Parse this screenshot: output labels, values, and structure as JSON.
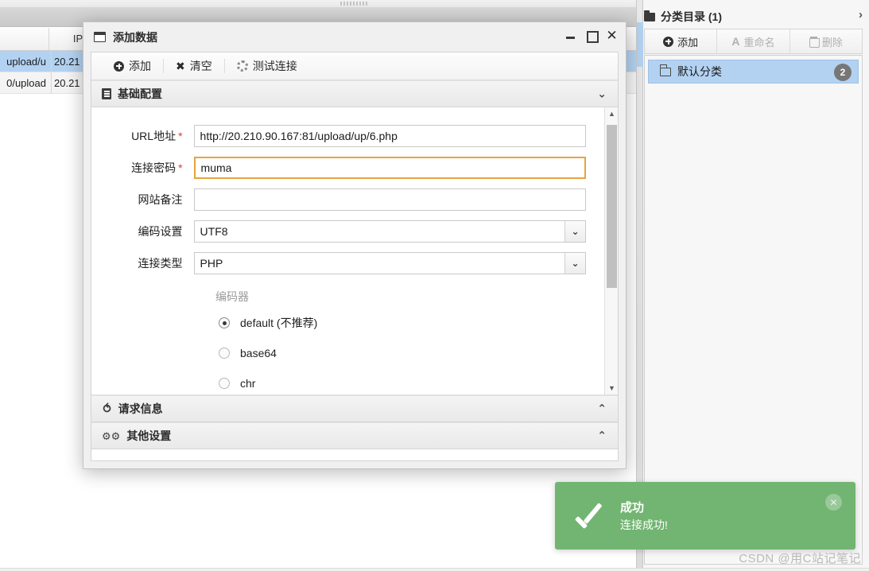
{
  "background": {
    "table": {
      "headers": [
        "",
        "IP地",
        ""
      ],
      "rows": [
        {
          "path": "upload/u",
          "ip": "20.21"
        },
        {
          "path": "0/upload",
          "ip": "20.21"
        }
      ]
    }
  },
  "sidebar": {
    "header_title": "分类目录 (1)",
    "header_icon": "folder-icon",
    "expand_icon": "chevron-right-icon",
    "toolbar": [
      {
        "label": "添加",
        "icon": "plus-circle-icon",
        "disabled": false
      },
      {
        "label": "重命名",
        "icon": "rename-A-icon",
        "disabled": true
      },
      {
        "label": "删除",
        "icon": "trash-icon",
        "disabled": true
      }
    ],
    "items": [
      {
        "label": "默认分类",
        "icon": "folder-outline-icon",
        "count": "2",
        "selected": true
      }
    ]
  },
  "dialog": {
    "title": "添加数据",
    "title_icon": "window-icon",
    "window_controls": {
      "minimize": "–",
      "maximize": "□",
      "close": "✕"
    },
    "toolbar": [
      {
        "label": "添加",
        "icon": "plus-circle-icon"
      },
      {
        "label": "清空",
        "icon": "x-icon"
      },
      {
        "label": "测试连接",
        "icon": "spinner-icon"
      }
    ],
    "sections": [
      {
        "title": "基础配置",
        "icon": "document-icon",
        "chevron": "⌄",
        "expanded": true
      },
      {
        "title": "请求信息",
        "icon": "refresh-icon",
        "chevron": "⌃",
        "expanded": false
      },
      {
        "title": "其他设置",
        "icon": "gears-icon",
        "chevron": "⌃",
        "expanded": false
      }
    ],
    "form": {
      "fields": [
        {
          "label": "URL地址",
          "required": true,
          "type": "text",
          "value": "http://20.210.90.167:81/upload/up/6.php",
          "placeholder": "",
          "focused": false
        },
        {
          "label": "连接密码",
          "required": true,
          "type": "text",
          "value": "muma",
          "placeholder": "",
          "focused": true
        },
        {
          "label": "网站备注",
          "required": false,
          "type": "text",
          "value": "",
          "placeholder": "",
          "focused": false
        },
        {
          "label": "编码设置",
          "required": false,
          "type": "select",
          "value": "UTF8",
          "placeholder": "",
          "focused": false
        },
        {
          "label": "连接类型",
          "required": false,
          "type": "select",
          "value": "PHP",
          "placeholder": "",
          "focused": false
        }
      ],
      "encoder_group_label": "编码器",
      "encoder_options": [
        {
          "label": "default (不推荐)",
          "selected": true
        },
        {
          "label": "base64",
          "selected": false
        },
        {
          "label": "chr",
          "selected": false
        }
      ]
    },
    "scrollbar": {
      "up_arrow": "▲",
      "down_arrow": "▼"
    }
  },
  "toast": {
    "title": "成功",
    "message": "连接成功!",
    "icon": "check-icon",
    "close_icon": "close-icon",
    "color": "#72b472"
  },
  "watermark": "CSDN @用C站记笔记"
}
